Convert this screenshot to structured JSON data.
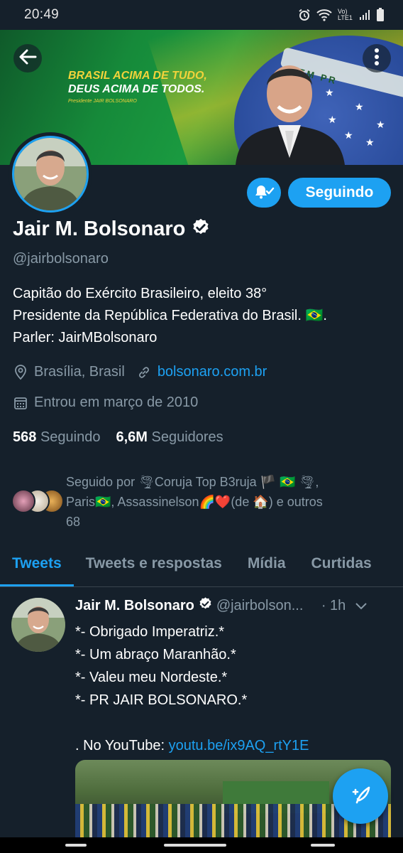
{
  "status_bar": {
    "time": "20:49",
    "network": "Vo) LTE1"
  },
  "banner": {
    "slogan_line1": "BRASIL ACIMA DE TUDO,",
    "slogan_line2": "DEUS ACIMA DE TODOS.",
    "signature": "Presidente JAIR BOLSONARO",
    "flag_band_text": "EM PR"
  },
  "profile": {
    "follow_button_label": "Seguindo",
    "name": "Jair M. Bolsonaro",
    "handle": "@jairbolsonaro",
    "bio_line1": "Capitão do Exército Brasileiro, eleito 38°",
    "bio_line2": "Presidente da República Federativa do Brasil. 🇧🇷.",
    "bio_line3": "Parler: JairMBolsonaro",
    "location": "Brasília, Brasil",
    "website": "bolsonaro.com.br",
    "joined": "Entrou em março de 2010",
    "following_count": "568",
    "following_label": "Seguindo",
    "followers_count": "6,6M",
    "followers_label": "Seguidores",
    "followed_by_line1": "Seguido por 🌪Coruja Top B3ruja 🏴 🇧🇷 🌪,",
    "followed_by_line2": "Paris🇧🇷, Assassinelson🌈❤️(de 🏠) e outros",
    "followed_by_line3": "68"
  },
  "tabs": [
    {
      "label": "Tweets",
      "active": true
    },
    {
      "label": "Tweets e respostas",
      "active": false
    },
    {
      "label": "Mídia",
      "active": false
    },
    {
      "label": "Curtidas",
      "active": false
    }
  ],
  "tweet": {
    "author_name": "Jair M. Bolsonaro",
    "author_handle": "@jairbolson...",
    "time": "· 1h",
    "lines": [
      "*- Obrigado Imperatriz.*",
      "*- Um abraço Maranhão.*",
      "*- Valeu meu Nordeste.*",
      "*- PR JAIR BOLSONARO.*"
    ],
    "link_prefix": ". No YouTube: ",
    "link_text": "youtu.be/ix9AQ_rtY1E"
  },
  "colors": {
    "background": "#15202b",
    "accent": "#1da1f2",
    "secondary_text": "#8899a6",
    "divider": "#38444d"
  },
  "icons": [
    "back-arrow-icon",
    "overflow-menu-icon",
    "bell-check-icon",
    "verified-badge-icon",
    "location-pin-icon",
    "link-icon",
    "calendar-icon",
    "chevron-down-icon",
    "compose-tweet-icon",
    "alarm-icon",
    "wifi-icon",
    "signal-icon",
    "battery-icon"
  ]
}
